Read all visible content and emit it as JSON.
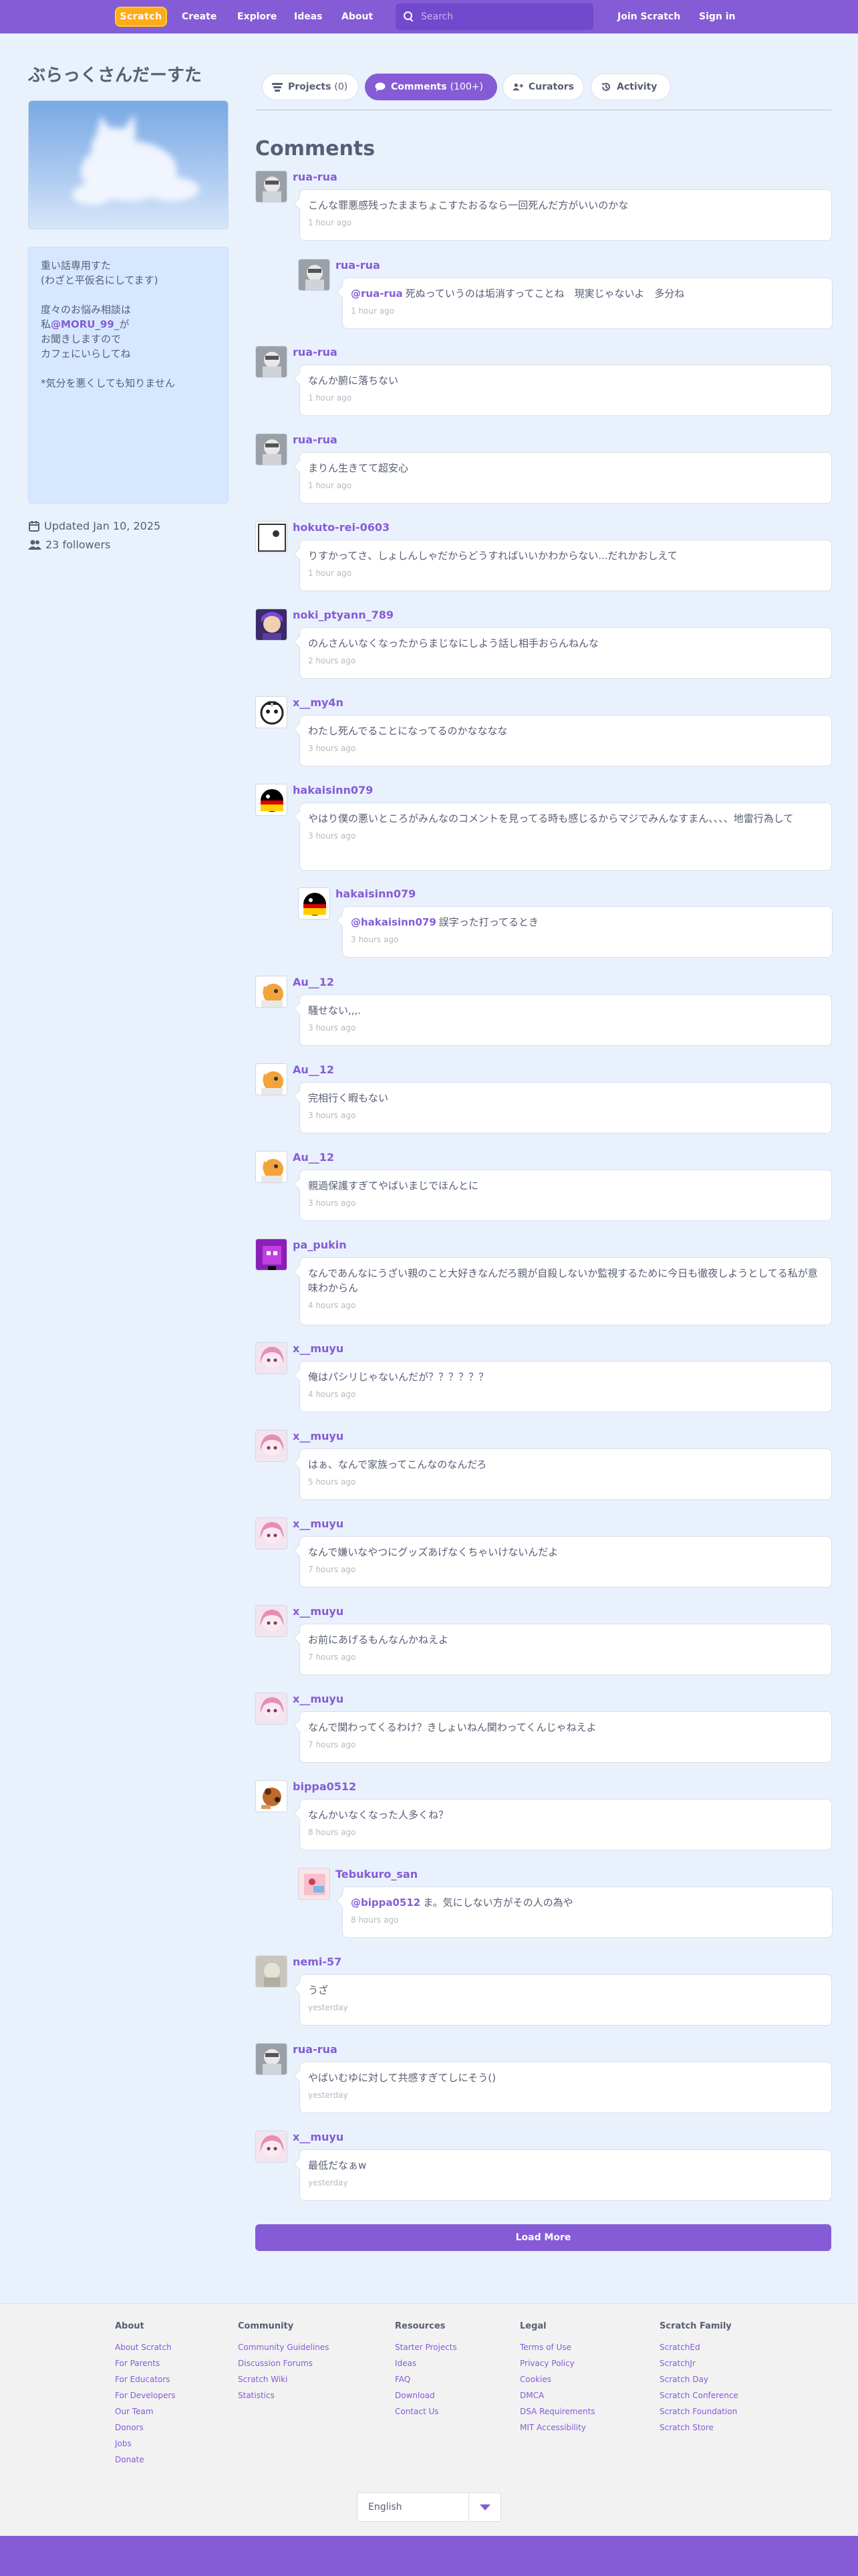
{
  "nav": {
    "logo": "Scratch",
    "links": [
      "Create",
      "Explore",
      "Ideas",
      "About"
    ],
    "search_placeholder": "Search",
    "join": "Join Scratch",
    "signin": "Sign in"
  },
  "studio": {
    "title": "ぶらっくさんだーすた",
    "description_pre": "重い話専用すた\n(わざと平仮名にしてます)\n\n度々のお悩み相談は\n私",
    "description_mention": "@MORU_99",
    "description_post": "_が\nお聞きしますので\nカフェにいらしてね\n\n*気分を悪くしても知りません",
    "updated": "Updated Jan 10, 2025",
    "followers": "23 followers"
  },
  "tabs": [
    {
      "label": "Projects",
      "count": "(0)"
    },
    {
      "label": "Comments",
      "count": "(100+)"
    },
    {
      "label": "Curators",
      "count": ""
    },
    {
      "label": "Activity",
      "count": ""
    }
  ],
  "section_title": "Comments",
  "comments": [
    {
      "user": "rua-rua",
      "mention": "",
      "text": "こんな罪悪感残ったままちょこすたおるなら一回死んだ方がいいのかな",
      "time": "1 hour ago"
    },
    {
      "user": "rua-rua",
      "mention": "@rua-rua",
      "text": "死ぬっていうのは垢消すってことね　現実じゃないよ　多分ね",
      "time": "1 hour ago"
    },
    {
      "user": "rua-rua",
      "mention": "",
      "text": "なんか腑に落ちない",
      "time": "1 hour ago"
    },
    {
      "user": "rua-rua",
      "mention": "",
      "text": "まりん生きてて超安心",
      "time": "1 hour ago"
    },
    {
      "user": "hokuto-rei-0603",
      "mention": "",
      "text": "りすかってさ、しょしんしゃだからどうすればいいかわからない...だれかおしえて",
      "time": "1 hour ago"
    },
    {
      "user": "noki_ptyann_789",
      "mention": "",
      "text": "のんさんいなくなったからまじなにしよう話し相手おらんねんな",
      "time": "2 hours ago"
    },
    {
      "user": "x__my4n",
      "mention": "",
      "text": "わたし死んでることになってるのかなななな",
      "time": "3 hours ago"
    },
    {
      "user": "hakaisinn079",
      "mention": "",
      "text": "やはり僕の悪いところがみんなのコメントを見ってる時も感じるからマジでみんなすまん、、、、地雷行為して",
      "time": "3 hours ago"
    },
    {
      "user": "hakaisinn079",
      "mention": "@hakaisinn079",
      "text": "誤字った打ってるとき",
      "time": "3 hours ago"
    },
    {
      "user": "Au__12",
      "mention": "",
      "text": "騒せない,,,.",
      "time": "3 hours ago"
    },
    {
      "user": "Au__12",
      "mention": "",
      "text": "完相行く暇もない",
      "time": "3 hours ago"
    },
    {
      "user": "Au__12",
      "mention": "",
      "text": "親過保護すぎてやばいまじでほんとに",
      "time": "3 hours ago"
    },
    {
      "user": "pa_pukin",
      "mention": "",
      "text": "なんであんなにうざい親のこと大好きなんだろ親が自殺しないか監視するために今日も徹夜しようとしてる私が意味わからん",
      "time": "4 hours ago"
    },
    {
      "user": "x__muyu",
      "mention": "",
      "text": "俺はパシリじゃないんだが？？？？？？",
      "time": "4 hours ago"
    },
    {
      "user": "x__muyu",
      "mention": "",
      "text": "はぁ、なんで家族ってこんなのなんだろ",
      "time": "5 hours ago"
    },
    {
      "user": "x__muyu",
      "mention": "",
      "text": "なんで嫌いなやつにグッズあげなくちゃいけないんだよ",
      "time": "7 hours ago"
    },
    {
      "user": "x__muyu",
      "mention": "",
      "text": "お前にあげるもんなんかねえよ",
      "time": "7 hours ago"
    },
    {
      "user": "x__muyu",
      "mention": "",
      "text": "なんで関わってくるわけ？きしょいねん関わってくんじゃねえよ",
      "time": "7 hours ago"
    },
    {
      "user": "bippa0512",
      "mention": "",
      "text": "なんかいなくなった人多くね？",
      "time": "8 hours ago"
    },
    {
      "user": "Tebukuro_san",
      "mention": "@bippa0512",
      "text": "ま。気にしない方がその人の為や",
      "time": "8 hours ago"
    },
    {
      "user": "nemi-57",
      "mention": "",
      "text": "うざ",
      "time": "yesterday"
    },
    {
      "user": "rua-rua",
      "mention": "",
      "text": "やばいむゆに対して共感すぎてしにそう()",
      "time": "yesterday"
    },
    {
      "user": "x__muyu",
      "mention": "",
      "text": "最低だなぁw",
      "time": "yesterday"
    }
  ],
  "load_more": "Load More",
  "footer": {
    "columns": [
      {
        "title": "About",
        "links": [
          "About Scratch",
          "For Parents",
          "For Educators",
          "For Developers",
          "Our Team",
          "Donors",
          "Jobs",
          "Donate"
        ]
      },
      {
        "title": "Community",
        "links": [
          "Community Guidelines",
          "Discussion Forums",
          "Scratch Wiki",
          "Statistics"
        ]
      },
      {
        "title": "Resources",
        "links": [
          "Starter Projects",
          "Ideas",
          "FAQ",
          "Download",
          "Contact Us"
        ]
      },
      {
        "title": "Legal",
        "links": [
          "Terms of Use",
          "Privacy Policy",
          "Cookies",
          "DMCA",
          "DSA Requirements",
          "MIT Accessibility"
        ]
      },
      {
        "title": "Scratch Family",
        "links": [
          "ScratchEd",
          "ScratchJr",
          "Scratch Day",
          "Scratch Conference",
          "Scratch Foundation",
          "Scratch Store"
        ]
      }
    ],
    "language": "English"
  },
  "colors": {
    "brand": "#855cd6",
    "background": "#e9f1fc",
    "text": "#575e75"
  }
}
